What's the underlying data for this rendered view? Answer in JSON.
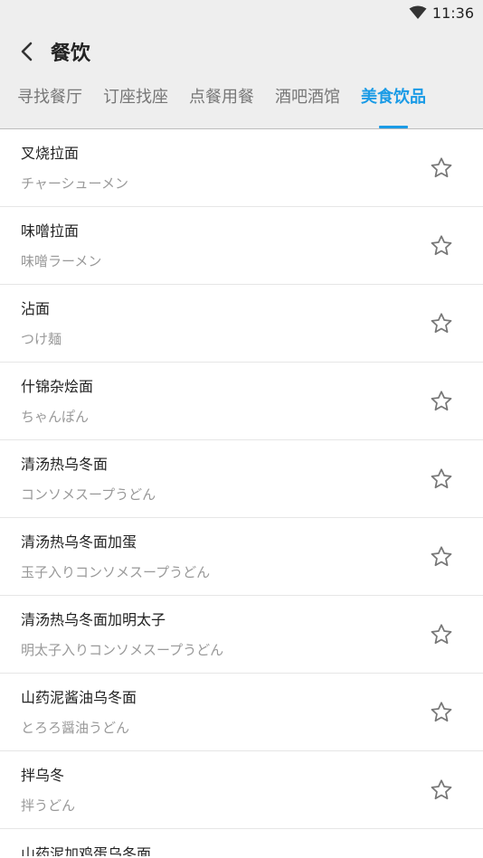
{
  "status": {
    "time": "11:36",
    "wifi_icon": "wifi-icon"
  },
  "appbar": {
    "title": "餐饮",
    "back_icon": "back-arrow-icon"
  },
  "tabs": [
    {
      "label": "寻找餐厅",
      "active": false
    },
    {
      "label": "订座找座",
      "active": false
    },
    {
      "label": "点餐用餐",
      "active": false
    },
    {
      "label": "酒吧酒馆",
      "active": false
    },
    {
      "label": "美食饮品",
      "active": true
    }
  ],
  "colors": {
    "accent": "#1a9be6",
    "header_bg": "#eeeeee",
    "divider": "#e6e6e6"
  },
  "items": [
    {
      "name": "叉烧拉面",
      "reading": "チャーシューメン"
    },
    {
      "name": "味噌拉面",
      "reading": "味噌ラーメン"
    },
    {
      "name": "沾面",
      "reading": "つけ麺"
    },
    {
      "name": "什锦杂烩面",
      "reading": "ちゃんぽん"
    },
    {
      "name": "清汤热乌冬面",
      "reading": "コンソメスープうどん"
    },
    {
      "name": "清汤热乌冬面加蛋",
      "reading": "玉子入りコンソメスープうどん"
    },
    {
      "name": "清汤热乌冬面加明太子",
      "reading": "明太子入りコンソメスープうどん"
    },
    {
      "name": "山药泥酱油乌冬面",
      "reading": "とろろ醤油うどん"
    },
    {
      "name": "拌乌冬",
      "reading": "拌うどん"
    }
  ],
  "partial_item": {
    "name": "山药泥加鸡蛋乌冬面"
  }
}
